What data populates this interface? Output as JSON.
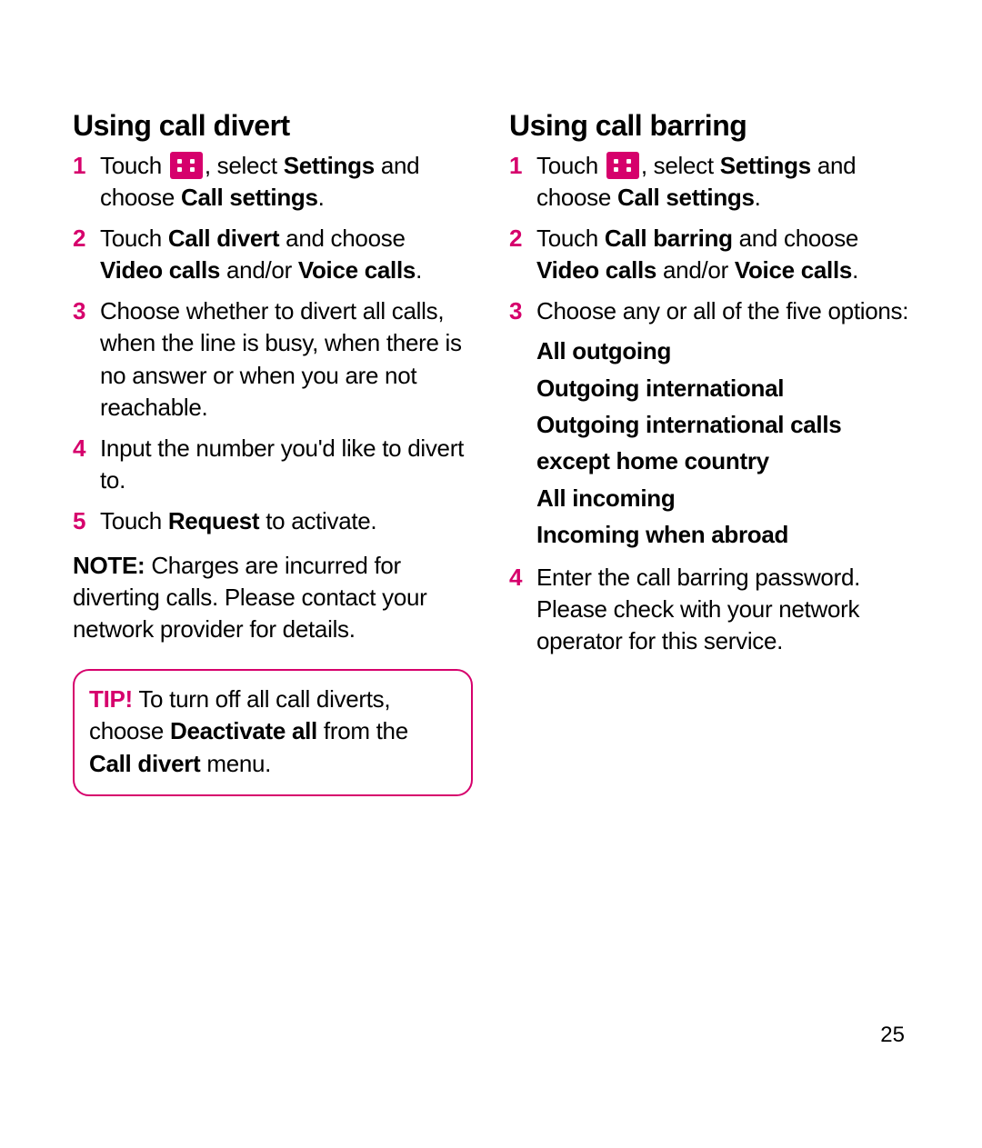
{
  "page_number": "25",
  "accent_color": "#d6006c",
  "icon_name": "menu-grid-icon",
  "left": {
    "heading": "Using call divert",
    "steps": [
      {
        "num": "1",
        "pre": "Touch ",
        "post1": ", select ",
        "b1": "Settings",
        "post2": " and choose ",
        "b2": "Call settings",
        "post3": "."
      },
      {
        "num": "2",
        "pre": "Touch ",
        "b1": "Call divert",
        "mid": " and choose ",
        "b2": "Video calls",
        "mid2": " and/or ",
        "b3": "Voice calls",
        "post": "."
      },
      {
        "num": "3",
        "text": "Choose whether to divert all calls, when the line is busy, when there is no answer or when you are not reachable."
      },
      {
        "num": "4",
        "text": "Input the number you'd like to divert to."
      },
      {
        "num": "5",
        "pre": "Touch ",
        "b1": "Request",
        "post": " to activate."
      }
    ],
    "note": {
      "label": "NOTE:",
      "text": " Charges are incurred for diverting calls. Please contact your network provider for details."
    },
    "tip": {
      "label": "TIP!",
      "pre": " To turn off all call diverts, choose ",
      "b1": "Deactivate all",
      "mid": " from the ",
      "b2": "Call divert",
      "post": " menu."
    }
  },
  "right": {
    "heading": "Using call barring",
    "steps": [
      {
        "num": "1",
        "pre": "Touch ",
        "post1": ", select ",
        "b1": "Settings",
        "post2": " and choose ",
        "b2": "Call settings",
        "post3": "."
      },
      {
        "num": "2",
        "pre": "Touch ",
        "b1": "Call barring",
        "mid": " and choose ",
        "b2": "Video calls",
        "mid2": " and/or ",
        "b3": "Voice calls",
        "post": "."
      },
      {
        "num": "3",
        "text": "Choose any or all of the five options:"
      }
    ],
    "options": [
      "All outgoing",
      "Outgoing international",
      "Outgoing international calls except home country",
      "All incoming",
      "Incoming when abroad"
    ],
    "step4": {
      "num": "4",
      "text": "Enter the call barring password. Please check with your network operator for this service."
    }
  }
}
